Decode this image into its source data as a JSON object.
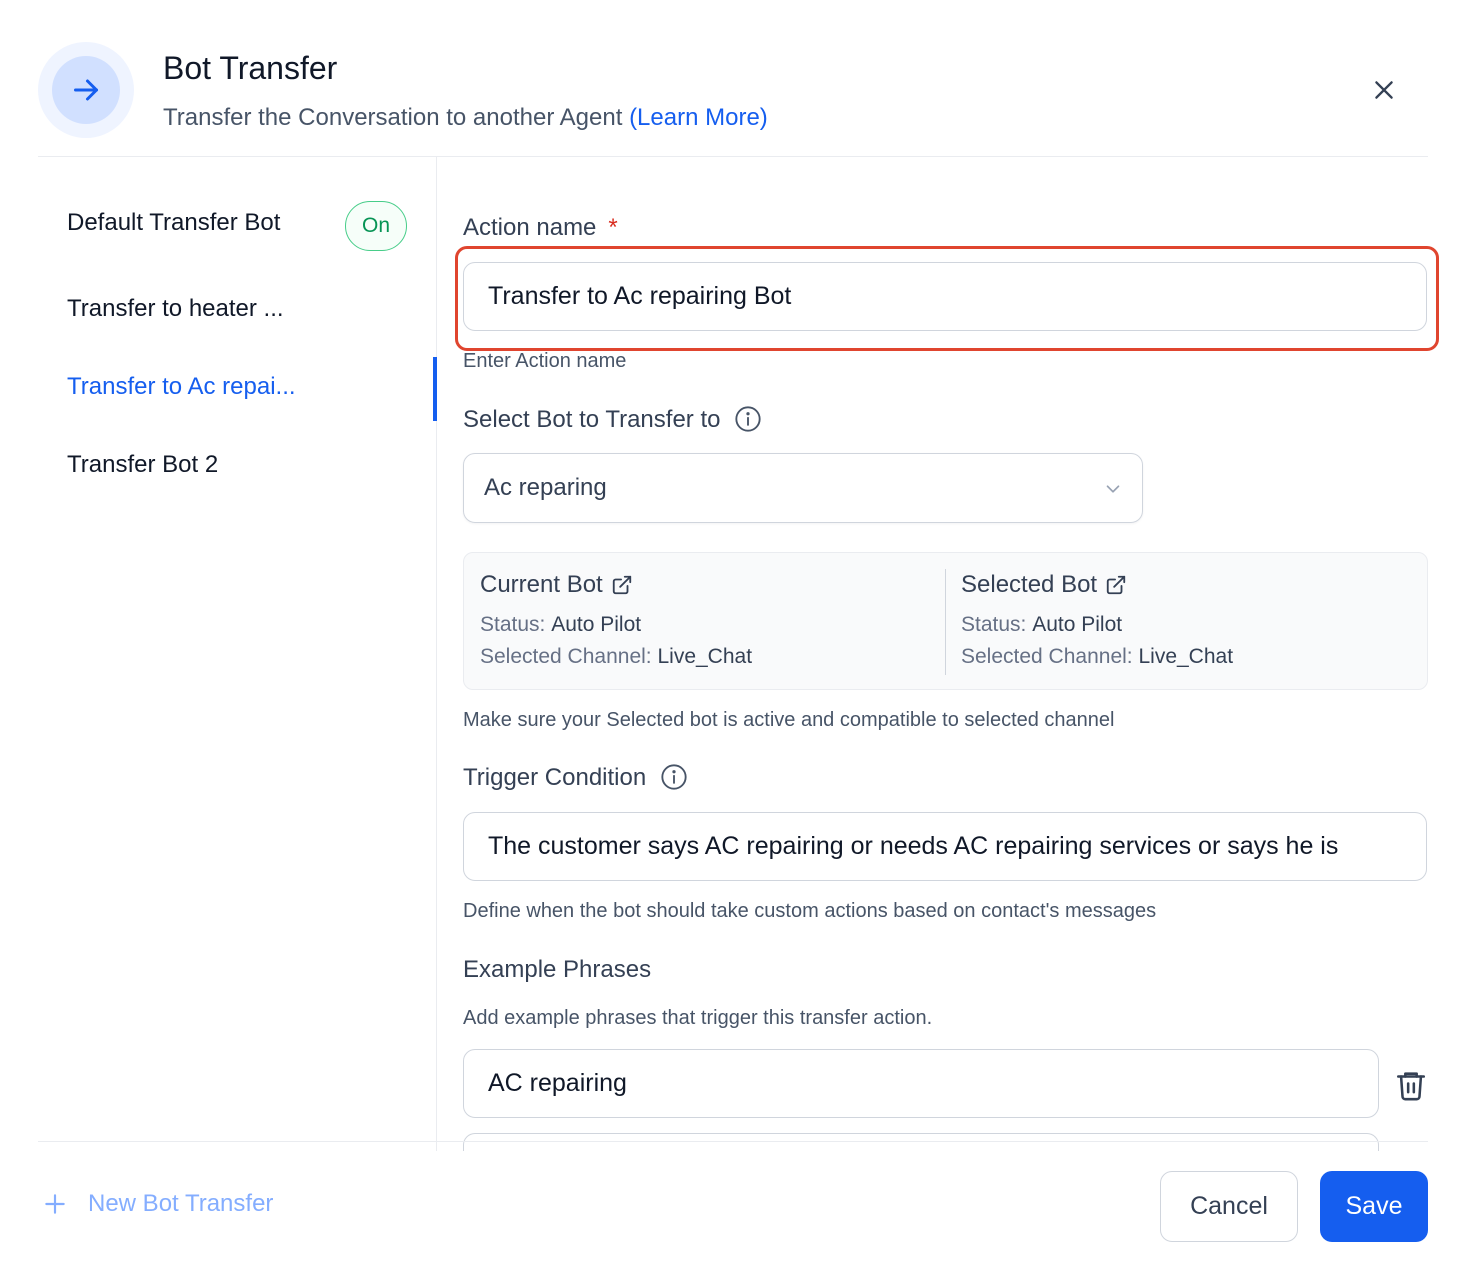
{
  "header": {
    "title": "Bot Transfer",
    "subtitle": "Transfer the Conversation to another Agent",
    "learn_more": "(Learn More)"
  },
  "sidebar": {
    "items": [
      {
        "label": "Default Transfer Bot",
        "badge": "On"
      },
      {
        "label": "Transfer to heater ..."
      },
      {
        "label": "Transfer to Ac repai...",
        "active": true
      },
      {
        "label": "Transfer Bot 2"
      }
    ],
    "new_button": "New Bot Transfer"
  },
  "form": {
    "action_name": {
      "label": "Action name",
      "required_mark": "*",
      "value": "Transfer to Ac repairing Bot",
      "hint": "Enter Action name"
    },
    "select_bot": {
      "label": "Select Bot to Transfer to",
      "value": "Ac reparing"
    },
    "current_bot": {
      "title": "Current Bot",
      "status_label": "Status:",
      "status_value": "Auto Pilot",
      "channel_label": "Selected Channel:",
      "channel_value": "Live_Chat"
    },
    "selected_bot": {
      "title": "Selected Bot",
      "status_label": "Status:",
      "status_value": "Auto Pilot",
      "channel_label": "Selected Channel:",
      "channel_value": "Live_Chat"
    },
    "compat_note": "Make sure your Selected bot is active and compatible to selected channel",
    "trigger": {
      "label": "Trigger Condition",
      "value": "The customer says AC repairing or needs AC repairing services or says he is",
      "hint": "Define when the bot should take custom actions based on contact's messages"
    },
    "examples": {
      "label": "Example Phrases",
      "hint": "Add example phrases that trigger this transfer action.",
      "phrases": [
        "AC repairing"
      ]
    }
  },
  "footer": {
    "cancel": "Cancel",
    "save": "Save"
  },
  "colors": {
    "accent": "#155eef",
    "highlight": "#e0452f",
    "badge_green": "#079455"
  }
}
